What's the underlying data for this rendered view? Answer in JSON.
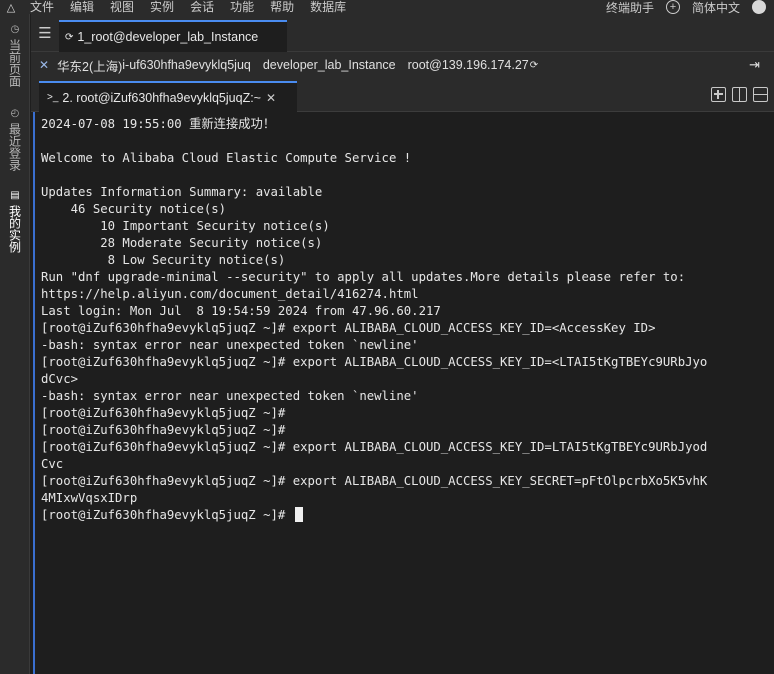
{
  "menubar": {
    "items": [
      "文件",
      "编辑",
      "视图",
      "实例",
      "会话",
      "功能",
      "帮助",
      "数据库"
    ],
    "assistant": "终端助手",
    "language": "简体中文"
  },
  "sidebar": {
    "items": [
      {
        "label": "当前页面",
        "icon": "clock-icon"
      },
      {
        "label": "最近登录",
        "icon": "history-icon"
      },
      {
        "label": "我的实例",
        "icon": "list-icon"
      }
    ]
  },
  "tabs_top": {
    "session_label": "1_root@developer_lab_Instance"
  },
  "infobar": {
    "region": "华东2(上海)",
    "instance_id": "i-uf630hfha9evyklq5juq",
    "instance_name": "developer_lab_Instance",
    "login": "root@139.196.174.27"
  },
  "tabs_terminal": {
    "label": "2. root@iZuf630hfha9evyklq5juqZ:~"
  },
  "terminal": {
    "lines": [
      "2024-07-08 19:55:00 重新连接成功！",
      "",
      "Welcome to Alibaba Cloud Elastic Compute Service !",
      "",
      "Updates Information Summary: available",
      "    46 Security notice(s)",
      "        10 Important Security notice(s)",
      "        28 Moderate Security notice(s)",
      "         8 Low Security notice(s)",
      "Run \"dnf upgrade-minimal --security\" to apply all updates.More details please refer to:",
      "https://help.aliyun.com/document_detail/416274.html",
      "Last login: Mon Jul  8 19:54:59 2024 from 47.96.60.217",
      "[root@iZuf630hfha9evyklq5juqZ ~]# export ALIBABA_CLOUD_ACCESS_KEY_ID=<AccessKey ID>",
      "-bash: syntax error near unexpected token `newline'",
      "[root@iZuf630hfha9evyklq5juqZ ~]# export ALIBABA_CLOUD_ACCESS_KEY_ID=<LTAI5tKgTBEYc9URbJyo",
      "dCvc>",
      "-bash: syntax error near unexpected token `newline'",
      "[root@iZuf630hfha9evyklq5juqZ ~]#",
      "[root@iZuf630hfha9evyklq5juqZ ~]#",
      "[root@iZuf630hfha9evyklq5juqZ ~]# export ALIBABA_CLOUD_ACCESS_KEY_ID=LTAI5tKgTBEYc9URbJyod",
      "Cvc",
      "[root@iZuf630hfha9evyklq5juqZ ~]# export ALIBABA_CLOUD_ACCESS_KEY_SECRET=pFtOlpcrbXo5K5vhK",
      "4MIxwVqsxIDrp"
    ],
    "prompt": "[root@iZuf630hfha9evyklq5juqZ ~]# "
  }
}
